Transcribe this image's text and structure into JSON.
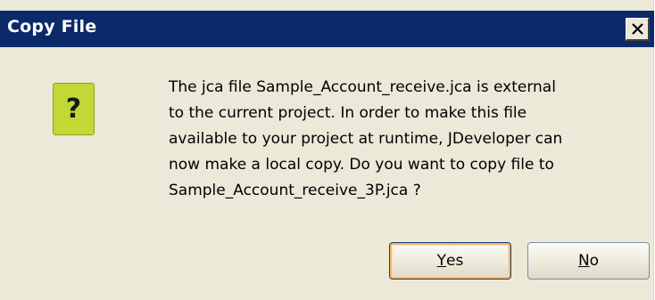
{
  "dialog": {
    "title": "Copy File",
    "close_glyph": "×"
  },
  "icon": {
    "name": "question-icon",
    "glyph": "?",
    "color": "#c2d935"
  },
  "message": {
    "lines": [
      "The jca file Sample_Account_receive.jca is external",
      "to the current project. In order to make this file",
      "available to your project at runtime, JDeveloper can",
      "now make a local copy. Do you want to copy file to",
      "Sample_Account_receive_3P.jca ?"
    ]
  },
  "buttons": {
    "yes": {
      "mnemonic": "Y",
      "rest": "es"
    },
    "no": {
      "mnemonic": "N",
      "rest": "o"
    }
  },
  "colors": {
    "titlebar": "#0b2a6a",
    "dialog_bg": "#ece9d8",
    "default_button_highlight": "#f4b860"
  }
}
